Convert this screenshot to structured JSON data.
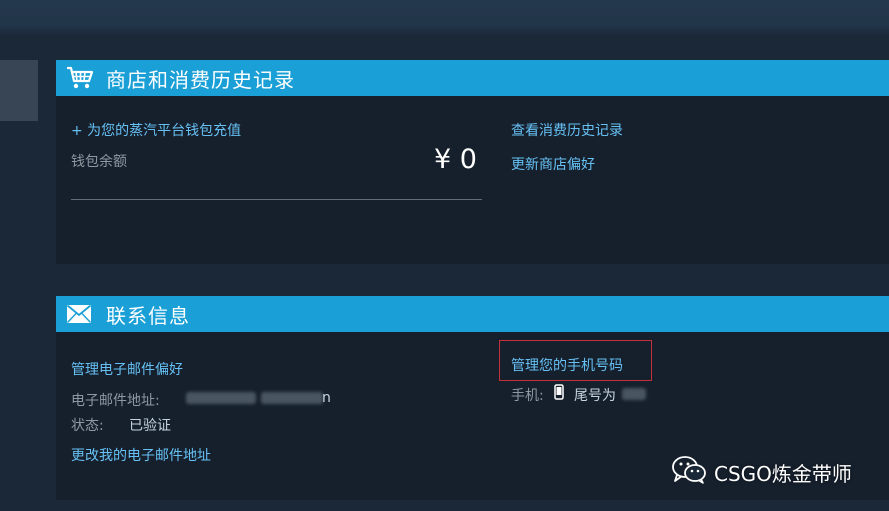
{
  "colors": {
    "background": "#1b2838",
    "panel": "#16202d",
    "header_bar": "#1a9fd6",
    "link": "#66c0f4",
    "label": "#8f98a0",
    "highlight_box": "#c6303a"
  },
  "store": {
    "title": "商店和消费历史记录",
    "icon": "cart-icon",
    "add_funds_link": "+ 为您的蒸汽平台钱包充值",
    "wallet_label": "钱包余额",
    "wallet_balance": "¥ 0",
    "history_link": "查看消费历史记录",
    "preferences_link": "更新商店偏好"
  },
  "contact": {
    "title": "联系信息",
    "icon": "envelope-icon",
    "email_prefs_link": "管理电子邮件偏好",
    "email_label": "电子邮件地址:",
    "email_suffix": "n",
    "status_label": "状态:",
    "status_value": "已验证",
    "change_email_link": "更改我的电子邮件地址",
    "manage_phone_link": "管理您的手机号码",
    "phone_label": "手机:",
    "phone_icon": "mobile-phone-icon",
    "phone_value": "尾号为"
  },
  "watermark": {
    "icon": "wechat-icon",
    "text": "CSGO炼金带师"
  }
}
